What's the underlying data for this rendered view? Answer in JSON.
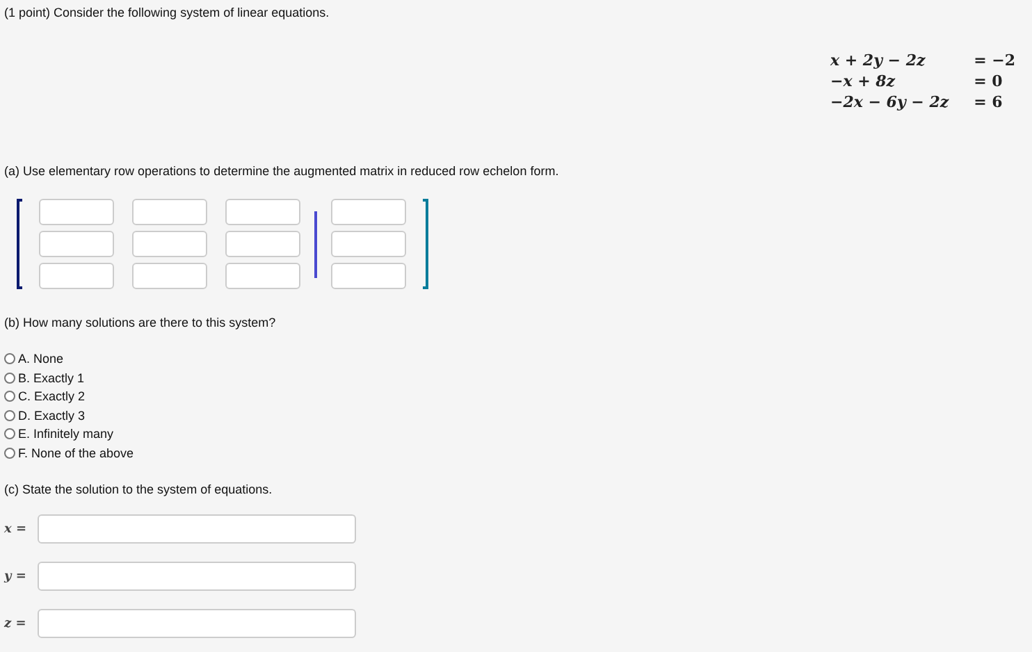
{
  "intro": "(1 point) Consider the following system of linear equations.",
  "equations": [
    {
      "lhs": "x + 2y − 2z",
      "rhs": "= −2"
    },
    {
      "lhs": "−x + 8z",
      "rhs": "= 0"
    },
    {
      "lhs": "−2x − 6y − 2z",
      "rhs": "= 6"
    }
  ],
  "part_a": {
    "prompt": "(a) Use elementary row operations to determine the augmented matrix in reduced row echelon form."
  },
  "part_b": {
    "prompt": "(b) How many solutions are there to this system?",
    "options": [
      {
        "label": "A. None",
        "selected": false
      },
      {
        "label": "B. Exactly 1",
        "selected": false
      },
      {
        "label": "C. Exactly 2",
        "selected": false
      },
      {
        "label": "D. Exactly 3",
        "selected": false
      },
      {
        "label": "E. Infinitely many",
        "selected": false
      },
      {
        "label": "F. None of the above",
        "selected": false
      }
    ]
  },
  "part_c": {
    "prompt": "(c) State the solution to the system of equations.",
    "answers": [
      {
        "label": "x ="
      },
      {
        "label": "y ="
      },
      {
        "label": "z ="
      }
    ]
  }
}
